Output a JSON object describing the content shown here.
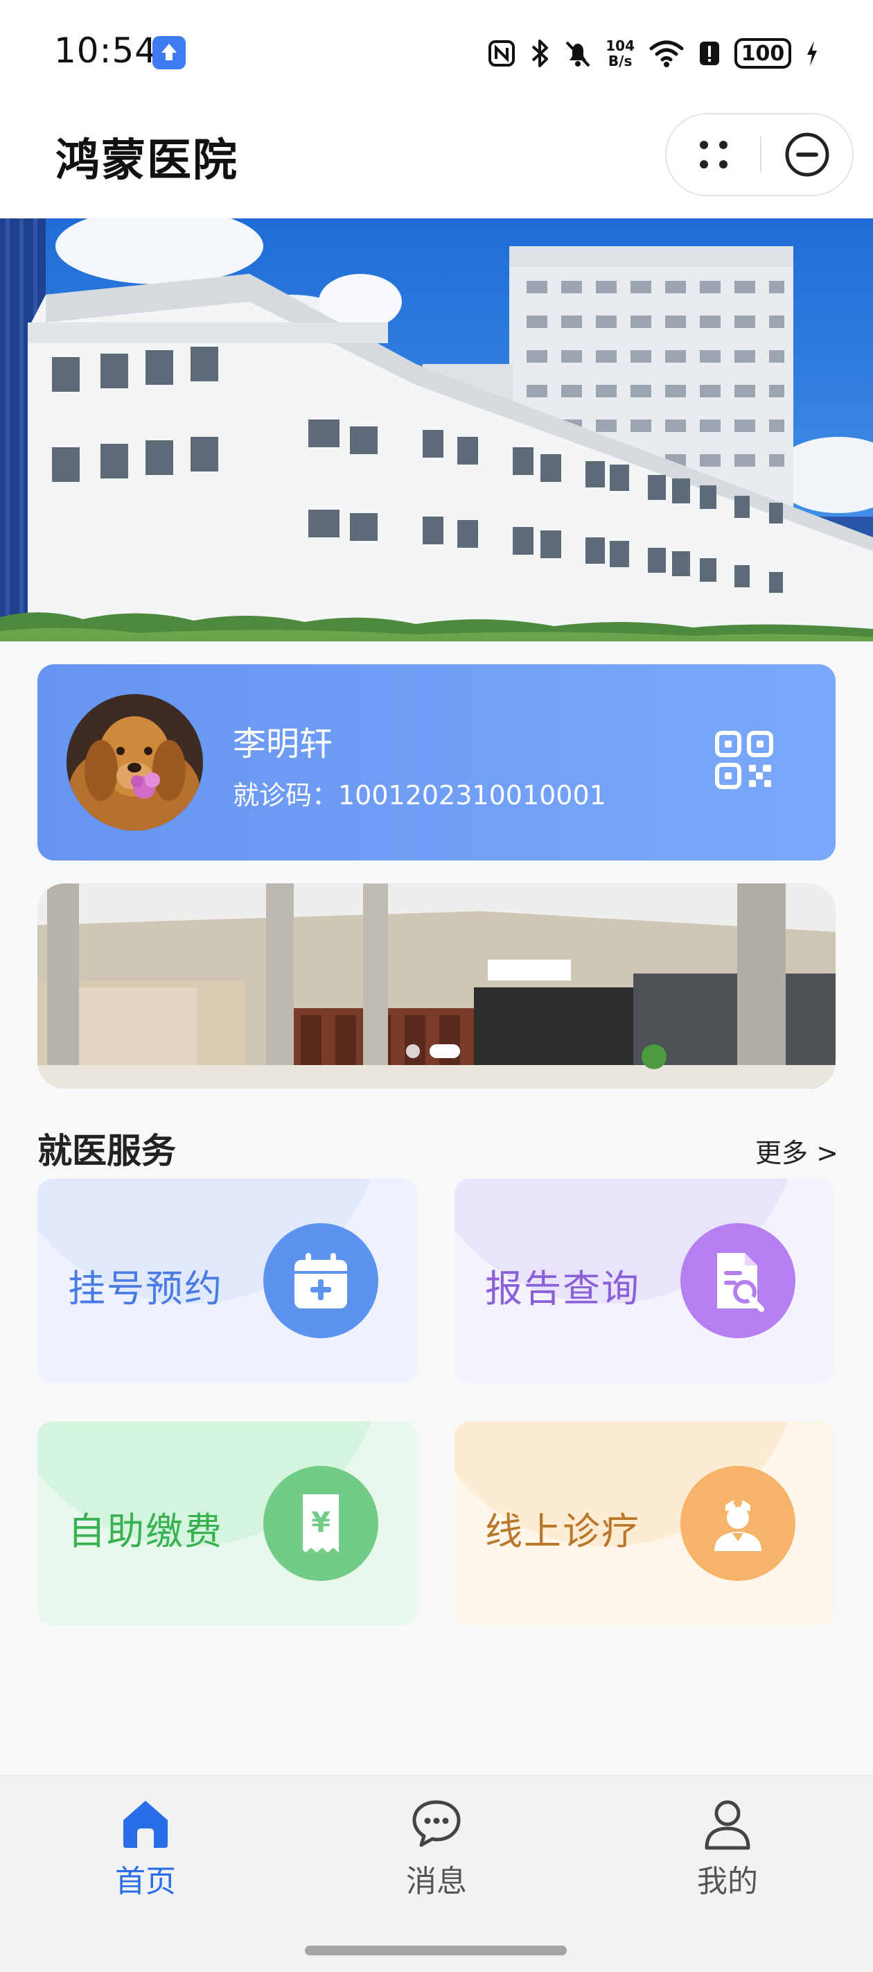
{
  "status_bar": {
    "time": "10:54",
    "net_speed_value": "104",
    "net_speed_unit": "B/s",
    "battery": "100",
    "icons": [
      "app-update-icon",
      "nfc-icon",
      "bluetooth-icon",
      "mute-icon",
      "wifi-icon",
      "alert-icon",
      "battery-icon",
      "charging-icon"
    ]
  },
  "header": {
    "title": "鸿蒙医院",
    "icons": [
      "more-dots-icon",
      "close-circle-icon"
    ]
  },
  "user_card": {
    "name": "李明轩",
    "id_text": "就诊码：1001202310010001",
    "icons": [
      "avatar-image",
      "qr-code-icon"
    ]
  },
  "banner": {
    "slide_count": 2,
    "active_slide": 2
  },
  "services": {
    "title": "就医服务",
    "more": "更多 >",
    "items": [
      {
        "label": "挂号预约",
        "icon": "calendar-plus-icon",
        "color": "#5b93ee"
      },
      {
        "label": "报告查询",
        "icon": "report-search-icon",
        "color": "#b57ff2"
      },
      {
        "label": "自助缴费",
        "icon": "payment-receipt-icon",
        "color": "#72cb86"
      },
      {
        "label": "线上诊疗",
        "icon": "doctor-icon",
        "color": "#f5b46a"
      }
    ]
  },
  "tab_bar": {
    "tabs": [
      {
        "label": "首页",
        "icon": "home-icon",
        "active": true
      },
      {
        "label": "消息",
        "icon": "message-icon",
        "active": false
      },
      {
        "label": "我的",
        "icon": "user-icon",
        "active": false
      }
    ],
    "accent": "#2a6de8"
  }
}
